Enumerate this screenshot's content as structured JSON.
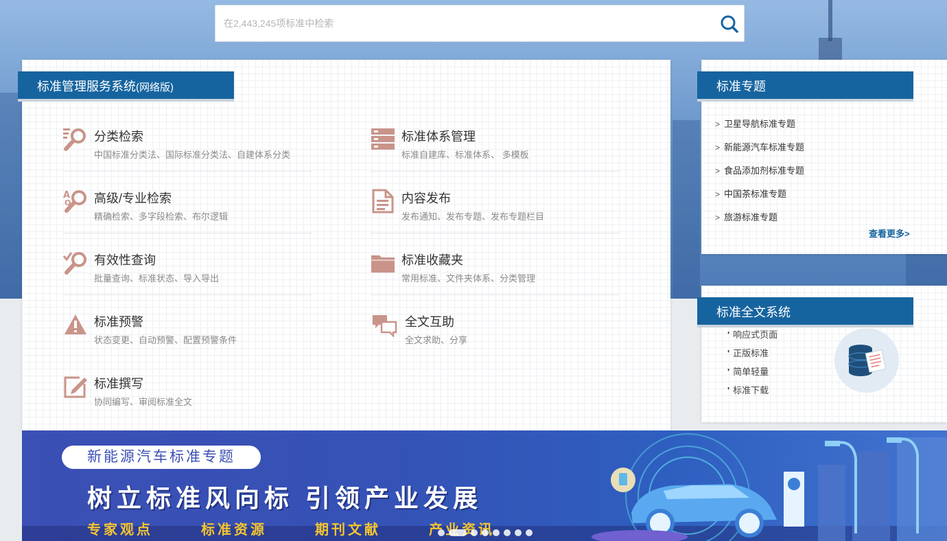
{
  "search": {
    "placeholder": "在2,443,245项标准中检索"
  },
  "main": {
    "title": "标准管理服务系统",
    "title_suffix": "(网络版)",
    "features": [
      {
        "icon": "category-search-icon",
        "name": "分类检索",
        "desc": "中国标准分类法、国际标准分类法、自建体系分类"
      },
      {
        "icon": "standard-system-icon",
        "name": "标准体系管理",
        "desc": "标准自建库、标准体系、 多模板"
      },
      {
        "icon": "advanced-search-icon",
        "name": "高级/专业检索",
        "desc": "精确检索、多字段检索、布尔逻辑"
      },
      {
        "icon": "content-publish-icon",
        "name": "内容发布",
        "desc": "发布通知、发布专题、发布专题栏目"
      },
      {
        "icon": "validity-query-icon",
        "name": "有效性查询",
        "desc": "批量查询、标准状态、导入导出"
      },
      {
        "icon": "folder-icon",
        "name": "标准收藏夹",
        "desc": "常用标准、文件夹体系、分类管理"
      },
      {
        "icon": "warning-icon",
        "name": "标准预警",
        "desc": "状态变更、自动预警、配置预警条件"
      },
      {
        "icon": "chat-icon",
        "name": "全文互助",
        "desc": "全文求助、分享"
      },
      {
        "icon": "edit-icon",
        "name": "标准撰写",
        "desc": "协同编写、审阅标准全文"
      }
    ]
  },
  "topics": {
    "title": "标准专题",
    "items": [
      "卫星导航标准专题",
      "新能源汽车标准专题",
      "食品添加剂标准专题",
      "中国茶标准专题",
      "旅游标准专题"
    ],
    "more": "查看更多>"
  },
  "fulltext": {
    "title": "标准全文系统",
    "items": [
      "响应式页面",
      "正版标准",
      "简单轻量",
      "标准下载"
    ]
  },
  "banner": {
    "pill": "新能源汽车标准专题",
    "slogan": "树立标准风向标 引领产业发展",
    "tags": [
      "专家观点",
      "标准资源",
      "期刊文献",
      "产业资讯"
    ]
  },
  "colors": {
    "accent": "#16649f",
    "icon": "#c9948a",
    "banner": "#3b4fb4",
    "banner_tags": "#f5c530"
  }
}
